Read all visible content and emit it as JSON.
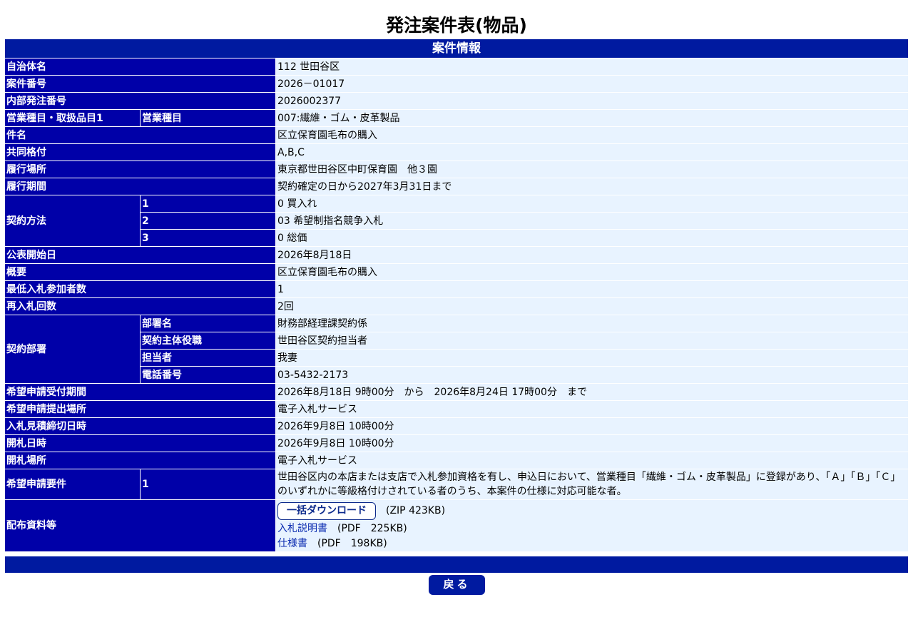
{
  "title": "発注案件表(物品)",
  "section_header": "案件情報",
  "rows": {
    "jichitai": {
      "label": "自治体名",
      "value": "112 世田谷区"
    },
    "anken_no": {
      "label": "案件番号",
      "value": "2026－01017"
    },
    "naibu_no": {
      "label": "内部発注番号",
      "value": "2026002377"
    },
    "eigyo": {
      "label": "営業種目・取扱品目1",
      "sublabel": "営業種目",
      "value": "007:繊維・ゴム・皮革製品"
    },
    "kenmei": {
      "label": "件名",
      "value": "区立保育園毛布の購入"
    },
    "kyodo": {
      "label": "共同格付",
      "value": "A,B,C"
    },
    "basho": {
      "label": "履行場所",
      "value": "東京都世田谷区中町保育園　他３園"
    },
    "kikan": {
      "label": "履行期間",
      "value": "契約確定の日から2027年3月31日まで"
    },
    "hoho": {
      "label": "契約方法",
      "items": [
        {
          "no": "1",
          "value": "0 買入れ"
        },
        {
          "no": "2",
          "value": "03 希望制指名競争入札"
        },
        {
          "no": "3",
          "value": "0 総価"
        }
      ]
    },
    "kohyo": {
      "label": "公表開始日",
      "value": "2026年8月18日"
    },
    "gaiyo": {
      "label": "概要",
      "value": "区立保育園毛布の購入"
    },
    "saitei": {
      "label": "最低入札参加者数",
      "value": "1"
    },
    "sainyu": {
      "label": "再入札回数",
      "value": "2回"
    },
    "busho": {
      "label": "契約部署",
      "items": [
        {
          "sublabel": "部署名",
          "value": "財務部経理課契約係"
        },
        {
          "sublabel": "契約主体役職",
          "value": "世田谷区契約担当者"
        },
        {
          "sublabel": "担当者",
          "value": "我妻"
        },
        {
          "sublabel": "電話番号",
          "value": "03-5432-2173"
        }
      ]
    },
    "uketsuke": {
      "label": "希望申請受付期間",
      "value": "2026年8月18日 9時00分　から　2026年8月24日 17時00分　まで"
    },
    "teishutsu": {
      "label": "希望申請提出場所",
      "value": "電子入札サービス"
    },
    "shimekiri": {
      "label": "入札見積締切日時",
      "value": "2026年9月8日 10時00分"
    },
    "kaisatsu_date": {
      "label": "開札日時",
      "value": "2026年9月8日 10時00分"
    },
    "kaisatsu_place": {
      "label": "開札場所",
      "value": "電子入札サービス"
    },
    "yoken": {
      "label": "希望申請要件",
      "no": "1",
      "value": "世田谷区内の本店または支店で入札参加資格を有し、申込日において、営業種目「繊維・ゴム・皮革製品」に登録があり、「Ａ」「Ｂ」「Ｃ」のいずれかに等級格付けされている者のうち、本案件の仕様に対応可能な者。"
    },
    "haifu": {
      "label": "配布資料等",
      "bulk_button": "一括ダウンロード",
      "bulk_info": "(ZIP 423KB)",
      "docs": [
        {
          "name": "入札説明書",
          "info": "(PDF　225KB)"
        },
        {
          "name": "仕様書",
          "info": "(PDF　198KB)"
        }
      ]
    }
  },
  "back_button": "戻る",
  "colors": {
    "header_blue": "#001aa0",
    "label_blue": "#0000a8",
    "value_bg": "#e8f3ff"
  }
}
